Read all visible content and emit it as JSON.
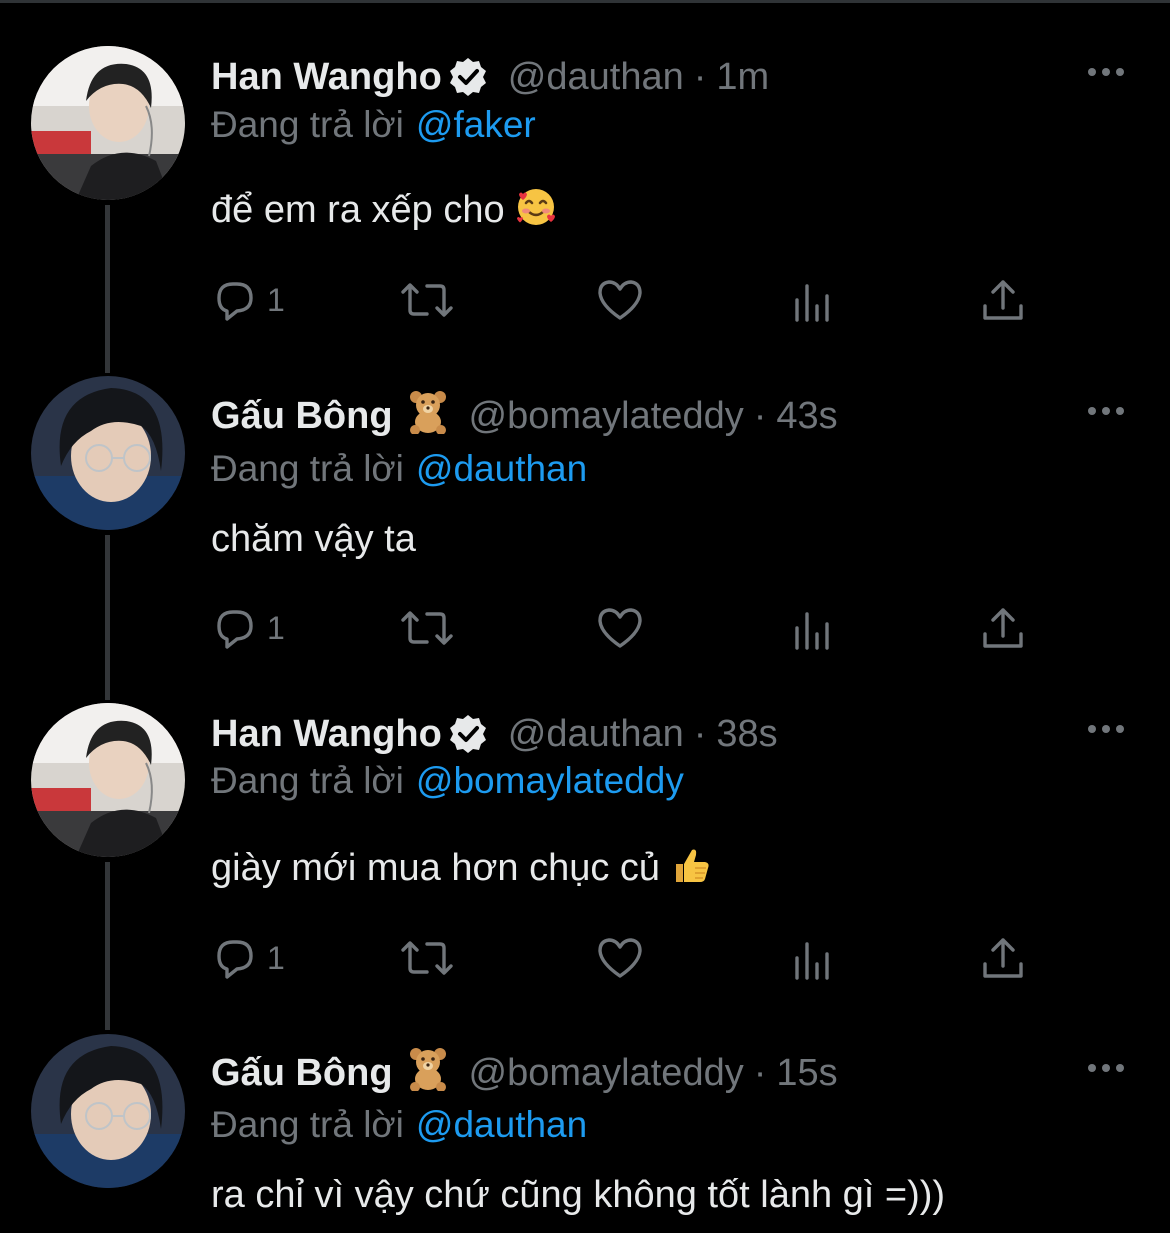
{
  "tweets": [
    {
      "name": "Han Wangho",
      "verified": true,
      "handle": "@dauthan",
      "time": "1m",
      "replying_label": "Đang trả lời",
      "replying_to": "@faker",
      "text": "để em ra xếp cho",
      "emoji": "smiling-face-with-hearts",
      "reply_count": "1"
    },
    {
      "name": "Gấu Bông",
      "verified": false,
      "name_emoji": "teddy-bear",
      "handle": "@bomaylateddy",
      "time": "43s",
      "replying_label": "Đang trả lời",
      "replying_to": "@dauthan",
      "text": "chăm vậy ta",
      "reply_count": "1"
    },
    {
      "name": "Han Wangho",
      "verified": true,
      "handle": "@dauthan",
      "time": "38s",
      "replying_label": "Đang trả lời",
      "replying_to": "@bomaylateddy",
      "text": "giày mới mua hơn chục củ",
      "emoji": "thumbs-up",
      "reply_count": "1"
    },
    {
      "name": "Gấu Bông",
      "verified": false,
      "name_emoji": "teddy-bear",
      "handle": "@bomaylateddy",
      "time": "15s",
      "replying_label": "Đang trả lời",
      "replying_to": "@dauthan",
      "text": "ra chỉ vì vậy chứ cũng không tốt lành gì =)))"
    }
  ],
  "dot_separator": "·",
  "icons": [
    "reply-icon",
    "retweet-icon",
    "like-icon",
    "views-icon",
    "share-icon",
    "more-icon",
    "verified-badge-icon"
  ],
  "colors": {
    "background": "#000000",
    "text": "#e7e9ea",
    "secondary": "#71767b",
    "link": "#1d9bf0",
    "thread_line": "#333639"
  }
}
